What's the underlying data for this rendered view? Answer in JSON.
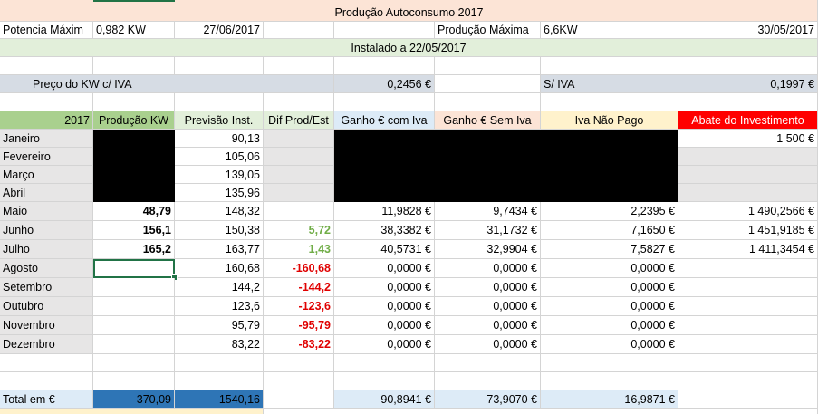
{
  "title": "Produção Autoconsumo 2017",
  "row2": {
    "a": "Potencia Máxim",
    "b": "0,982 KW",
    "c": "27/06/2017",
    "e": "Produção Máxima",
    "f": "6,6KW",
    "g": "30/05/2017"
  },
  "row3": {
    "text": "Instalado a 22/05/2017"
  },
  "row5": {
    "a": "Preço do KW  c/ IVA",
    "d": "0,2456 €",
    "e": "S/ IVA",
    "g": "0,1997 €"
  },
  "headers": [
    "2017",
    "Produção KW",
    "Previsão Inst.",
    "Dif Prod/Est",
    "Ganho € com Iva",
    "Ganho € Sem Iva",
    "Iva Não Pago",
    "Abate do Investimento"
  ],
  "months": [
    {
      "name": "Janeiro",
      "prod": "",
      "prev": "90,13",
      "dif": "",
      "gciva": "",
      "gsiva": "",
      "iva": "",
      "abate": "1 500 €"
    },
    {
      "name": "Fevereiro",
      "prod": "",
      "prev": "105,06",
      "dif": "",
      "gciva": "",
      "gsiva": "",
      "iva": "",
      "abate": ""
    },
    {
      "name": "Março",
      "prod": "",
      "prev": "139,05",
      "dif": "",
      "gciva": "",
      "gsiva": "",
      "iva": "",
      "abate": ""
    },
    {
      "name": "Abril",
      "prod": "",
      "prev": "135,96",
      "dif": "",
      "gciva": "",
      "gsiva": "",
      "iva": "",
      "abate": ""
    },
    {
      "name": "Maio",
      "prod": "48,79",
      "prev": "148,32",
      "dif": "",
      "gciva": "11,9828 €",
      "gsiva": "9,7434 €",
      "iva": "2,2395 €",
      "abate": "1 490,2566 €"
    },
    {
      "name": "Junho",
      "prod": "156,1",
      "prev": "150,38",
      "dif": "5,72",
      "gciva": "38,3382 €",
      "gsiva": "31,1732 €",
      "iva": "7,1650 €",
      "abate": "1 451,9185 €"
    },
    {
      "name": "Julho",
      "prod": "165,2",
      "prev": "163,77",
      "dif": "1,43",
      "gciva": "40,5731 €",
      "gsiva": "32,9904 €",
      "iva": "7,5827 €",
      "abate": "1 411,3454 €"
    },
    {
      "name": "Agosto",
      "prod": "",
      "prev": "160,68",
      "dif": "-160,68",
      "gciva": "0,0000 €",
      "gsiva": "0,0000 €",
      "iva": "0,0000 €",
      "abate": ""
    },
    {
      "name": "Setembro",
      "prod": "",
      "prev": "144,2",
      "dif": "-144,2",
      "gciva": "0,0000 €",
      "gsiva": "0,0000 €",
      "iva": "0,0000 €",
      "abate": ""
    },
    {
      "name": "Outubro",
      "prod": "",
      "prev": "123,6",
      "dif": "-123,6",
      "gciva": "0,0000 €",
      "gsiva": "0,0000 €",
      "iva": "0,0000 €",
      "abate": ""
    },
    {
      "name": "Novembro",
      "prod": "",
      "prev": "95,79",
      "dif": "-95,79",
      "gciva": "0,0000 €",
      "gsiva": "0,0000 €",
      "iva": "0,0000 €",
      "abate": ""
    },
    {
      "name": "Dezembro",
      "prod": "",
      "prev": "83,22",
      "dif": "-83,22",
      "gciva": "0,0000 €",
      "gsiva": "0,0000 €",
      "iva": "0,0000 €",
      "abate": ""
    }
  ],
  "total": {
    "label": "Total em €",
    "prod": "370,09",
    "prev": "1540,16",
    "gciva": "90,8941 €",
    "gsiva": "73,9070 €",
    "iva": "16,9871 €"
  },
  "colors": {
    "header_green": "#a9d08e",
    "red_abate": "#ff0000",
    "total_blue": "#2e75b6"
  }
}
